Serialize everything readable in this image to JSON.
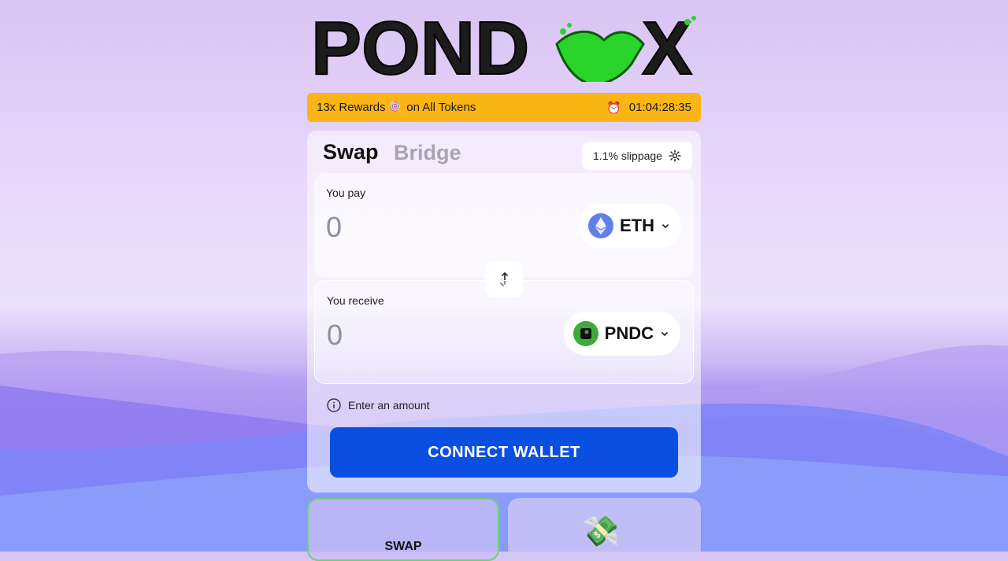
{
  "brand": {
    "logo_text": "POND",
    "logo_text_2": "X"
  },
  "promo": {
    "rewards_prefix": "13x Rewards",
    "rewards_suffix": "on All Tokens",
    "timer": "01:04:28:35"
  },
  "swap_card": {
    "tabs": {
      "swap": "Swap",
      "bridge": "Bridge"
    },
    "slippage": "1.1% slippage",
    "pay": {
      "label": "You pay",
      "amount": "0",
      "token": "ETH"
    },
    "receive": {
      "label": "You receive",
      "amount": "0",
      "token": "PNDC"
    },
    "hint": "Enter an amount",
    "connect_label": "CONNECT WALLET"
  },
  "bottom": {
    "swap_label": "SWAP"
  },
  "colors": {
    "accent": "#0a4fe0",
    "promo": "#fbb514",
    "logo_green": "#2ad42a"
  }
}
